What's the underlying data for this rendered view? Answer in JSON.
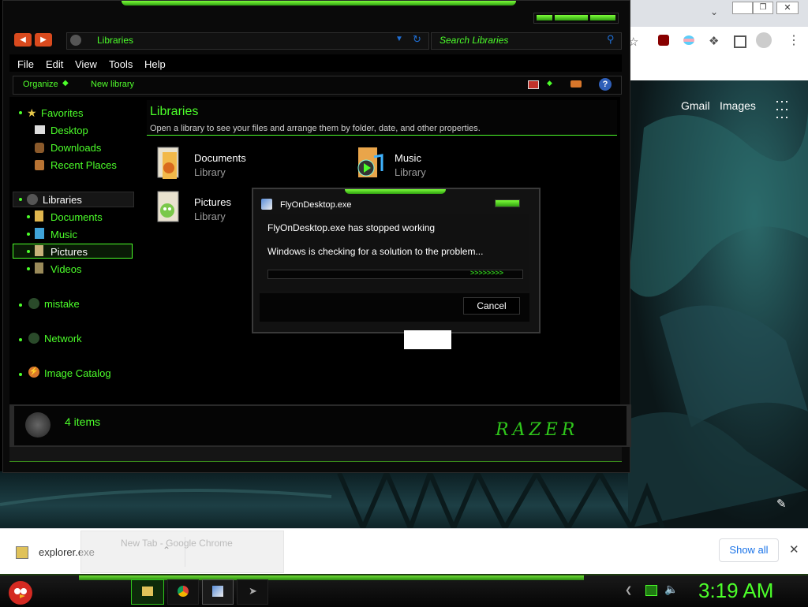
{
  "explorer": {
    "address_text": "Libraries",
    "search_placeholder": "Search Libraries",
    "menu": [
      "File",
      "Edit",
      "View",
      "Tools",
      "Help"
    ],
    "commands": {
      "organize": "Organize",
      "new_library": "New library"
    },
    "nav": {
      "favorites": "Favorites",
      "desktop": "Desktop",
      "downloads": "Downloads",
      "recent": "Recent Places",
      "libraries": "Libraries",
      "documents": "Documents",
      "music": "Music",
      "pictures": "Pictures",
      "videos": "Videos",
      "mistake": "mistake",
      "network": "Network",
      "image_catalog": "Image Catalog"
    },
    "header": {
      "title": "Libraries",
      "desc": "Open a library to see your files and arrange them by folder, date, and other properties."
    },
    "libraries": [
      {
        "name": "Documents",
        "type": "Library"
      },
      {
        "name": "Music",
        "type": "Library"
      },
      {
        "name": "Pictures",
        "type": "Library"
      }
    ],
    "status": {
      "count": "4 items"
    },
    "brand": "RAZER"
  },
  "dialog": {
    "title": "FlyOnDesktop.exe",
    "message": "FlyOnDesktop.exe has stopped working",
    "checking": "Windows is checking for a solution to the problem...",
    "progress_glyphs": ">>>>>>>>",
    "cancel": "Cancel"
  },
  "chrome": {
    "links": {
      "gmail": "Gmail",
      "images": "Images"
    },
    "download_file": "explorer.exe",
    "show_all": "Show all",
    "tooltip": "New Tab - Google Chrome"
  },
  "taskbar": {
    "clock": "3:19 AM"
  },
  "colors": {
    "accent_green": "#4cff2a",
    "dark_bg": "#0a0a0a",
    "chrome_blue": "#1a73e8"
  },
  "icons": [
    "folder-icon",
    "chrome-icon",
    "angry-bird-icon",
    "speaker-icon",
    "battery-icon",
    "puzzle-icon",
    "profile-icon",
    "help-icon"
  ]
}
